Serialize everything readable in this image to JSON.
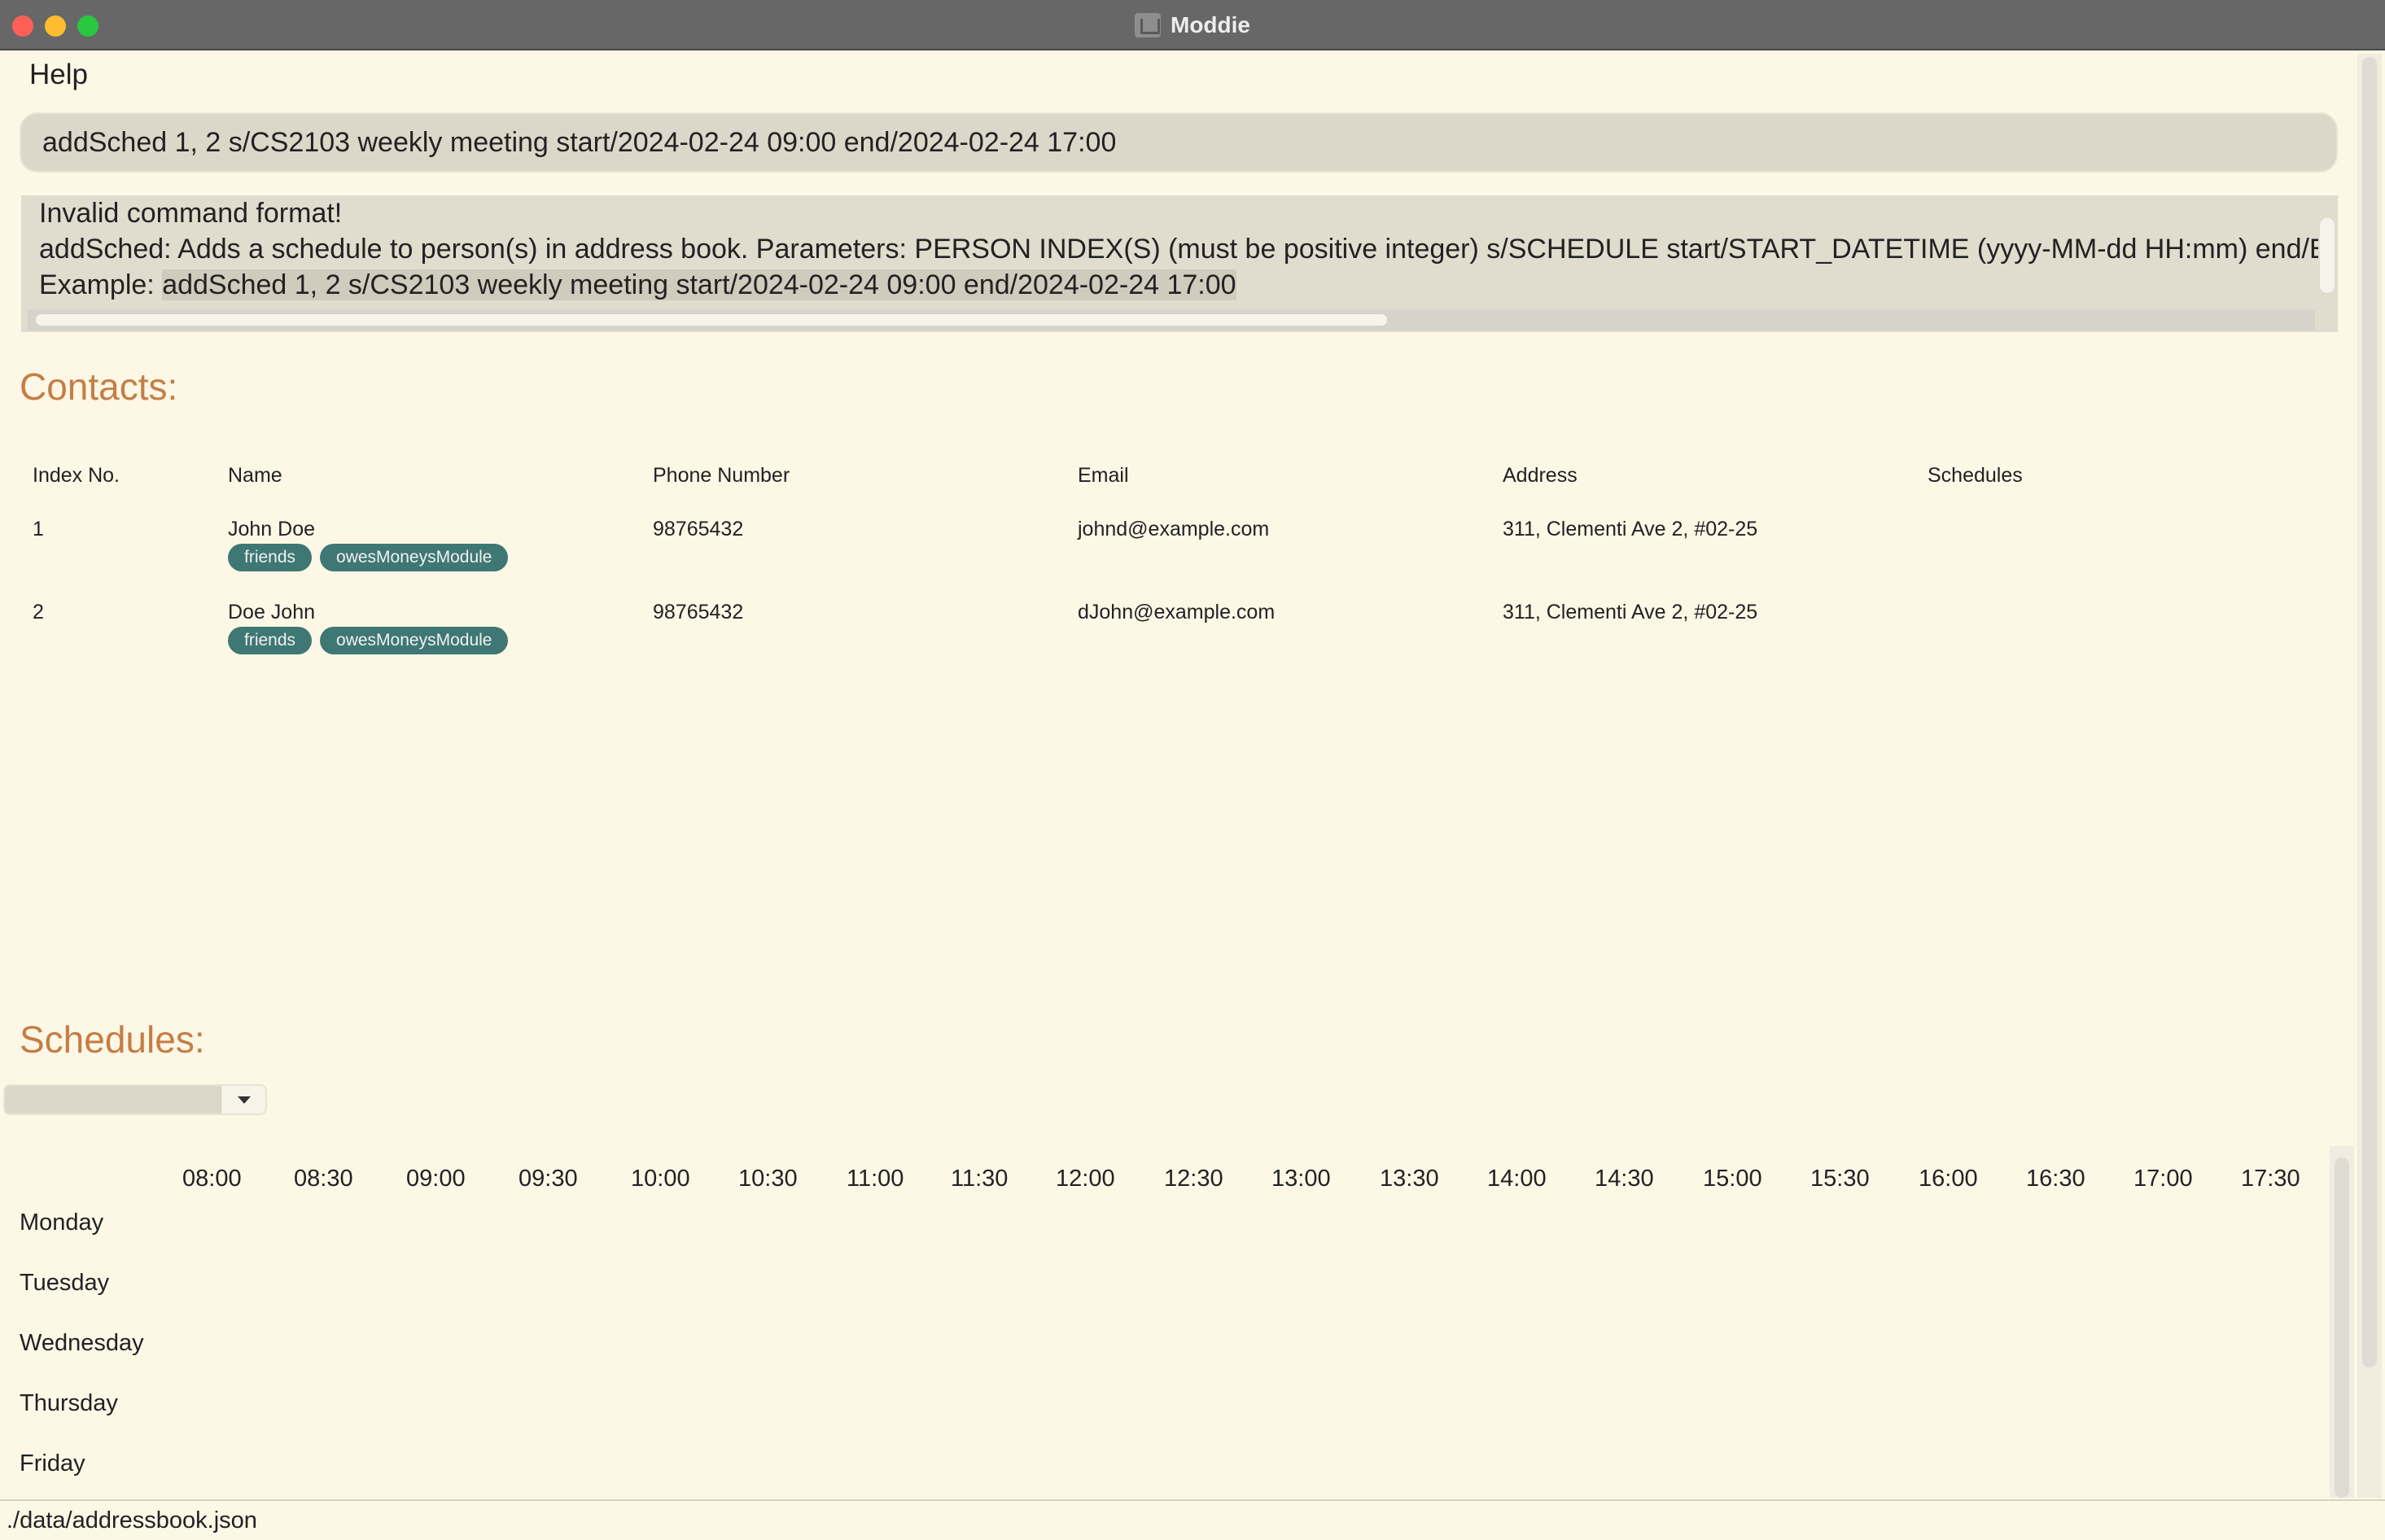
{
  "window": {
    "title": "Moddie"
  },
  "menu": {
    "help": "Help"
  },
  "command": {
    "value": "addSched 1, 2 s/CS2103 weekly meeting start/2024-02-24 09:00 end/2024-02-24 17:00"
  },
  "result": {
    "line1": "Invalid command format!",
    "line2": "addSched: Adds a schedule to person(s) in address book. Parameters: PERSON INDEX(S) (must be positive integer) s/SCHEDULE start/START_DATETIME (yyyy-MM-dd HH:mm) end/END_DAT",
    "line3_prefix": "Example: ",
    "line3_example": "addSched 1, 2 s/CS2103 weekly meeting start/2024-02-24 09:00 end/2024-02-24 17:00"
  },
  "contacts": {
    "title": "Contacts:",
    "headers": [
      "Index No.",
      "Name",
      "Phone Number",
      "Email",
      "Address",
      "Schedules"
    ],
    "rows": [
      {
        "index": "1",
        "name": "John Doe",
        "phone": "98765432",
        "email": "johnd@example.com",
        "address": "311, Clementi Ave 2, #02-25",
        "tags": [
          "friends",
          "owesMoneysModule"
        ]
      },
      {
        "index": "2",
        "name": "Doe John",
        "phone": "98765432",
        "email": "dJohn@example.com",
        "address": "311, Clementi Ave 2, #02-25",
        "tags": [
          "friends",
          "owesMoneysModule"
        ]
      }
    ]
  },
  "schedules": {
    "title": "Schedules:",
    "dropdown_value": "",
    "times": [
      "08:00",
      "08:30",
      "09:00",
      "09:30",
      "10:00",
      "10:30",
      "11:00",
      "11:30",
      "12:00",
      "12:30",
      "13:00",
      "13:30",
      "14:00",
      "14:30",
      "15:00",
      "15:30",
      "16:00",
      "16:30",
      "17:00",
      "17:30"
    ],
    "days": [
      "Monday",
      "Tuesday",
      "Wednesday",
      "Thursday",
      "Friday"
    ]
  },
  "status": {
    "path": "./data/addressbook.json"
  },
  "colors": {
    "accent": "#c47e45",
    "tag": "#3e7773",
    "background": "#fdf7e6",
    "titlebar": "#676767"
  },
  "icons": {
    "dropdown": "chevron-down-icon",
    "app": "app-icon"
  }
}
